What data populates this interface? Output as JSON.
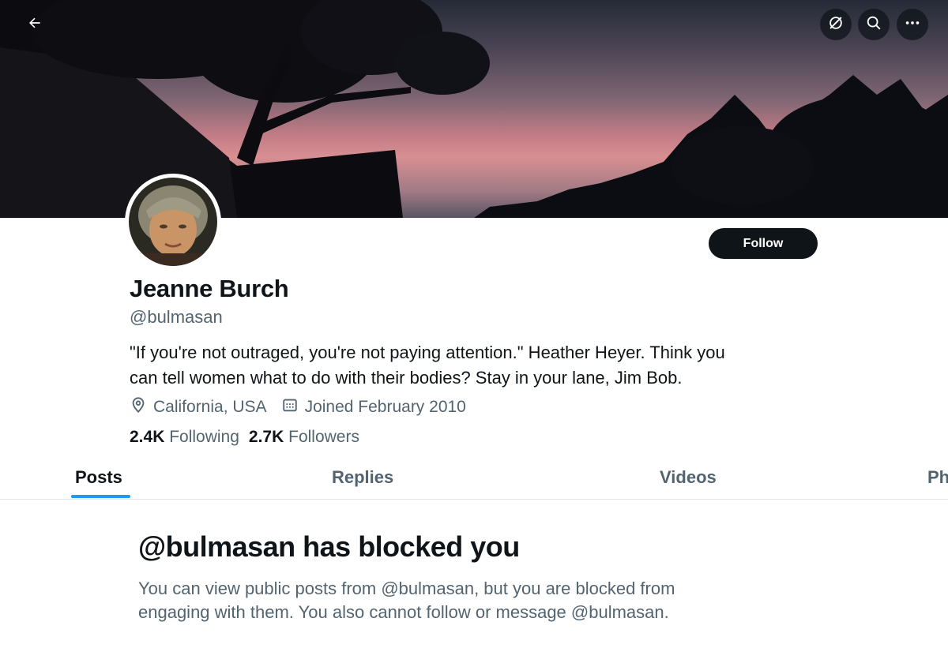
{
  "header": {
    "back_icon": "arrow-left-icon",
    "actions": [
      {
        "icon": "grok-icon"
      },
      {
        "icon": "search-icon"
      },
      {
        "icon": "more-icon"
      }
    ]
  },
  "profile": {
    "name": "Jeanne Burch",
    "handle": "@bulmasan",
    "follow_label": "Follow",
    "bio_line1": "\"If you're not outraged, you're not paying attention.\" Heather Heyer. Think you",
    "bio_line2": "can tell women what to do with their bodies? Stay in your lane, Jim Bob.",
    "location": "California, USA",
    "joined": "Joined February 2010",
    "following_count": "2.4K",
    "following_label": "Following",
    "followers_count": "2.7K",
    "followers_label": "Followers"
  },
  "tabs": [
    {
      "label": "Posts",
      "active": true
    },
    {
      "label": "Replies",
      "active": false
    },
    {
      "label": "Videos",
      "active": false
    },
    {
      "label": "Ph",
      "active": false
    }
  ],
  "blocked": {
    "title": "@bulmasan has blocked you",
    "line1": "You can view public posts from @bulmasan, but you are blocked from",
    "line2": "engaging with them. You also cannot follow or message @bulmasan."
  },
  "colors": {
    "accent": "#1d9bf0",
    "text_primary": "#0f1419",
    "text_secondary": "#536471"
  }
}
